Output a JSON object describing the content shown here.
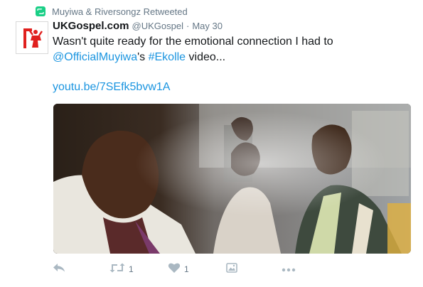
{
  "retweet_context": {
    "text": "Muyiwa & Riversongz Retweeted",
    "icon": "retweet-icon"
  },
  "tweet": {
    "author_name": "UKGospel.com",
    "handle": "@UKGospel",
    "separator": "·",
    "date": "May 30",
    "text_part1": "Wasn't quite ready for the emotional connection I had to ",
    "mention": "@OfficialMuyiwa",
    "text_part2": "'s ",
    "hashtag": "#Ekolle",
    "text_part3": " video...",
    "url": "youtu.be/7SEfk5bvw1A"
  },
  "actions": {
    "reply": {
      "icon": "reply-icon"
    },
    "retweet": {
      "icon": "retweet-icon",
      "count": "1"
    },
    "like": {
      "icon": "heart-icon",
      "count": "1"
    },
    "photo": {
      "icon": "photo-icon"
    },
    "more": {
      "icon": "more-icon",
      "label": "•••"
    }
  },
  "colors": {
    "link": "#1b95e0",
    "secondary_text": "#657786",
    "retweet_green": "#19cf86",
    "avatar_red": "#e0201e"
  }
}
